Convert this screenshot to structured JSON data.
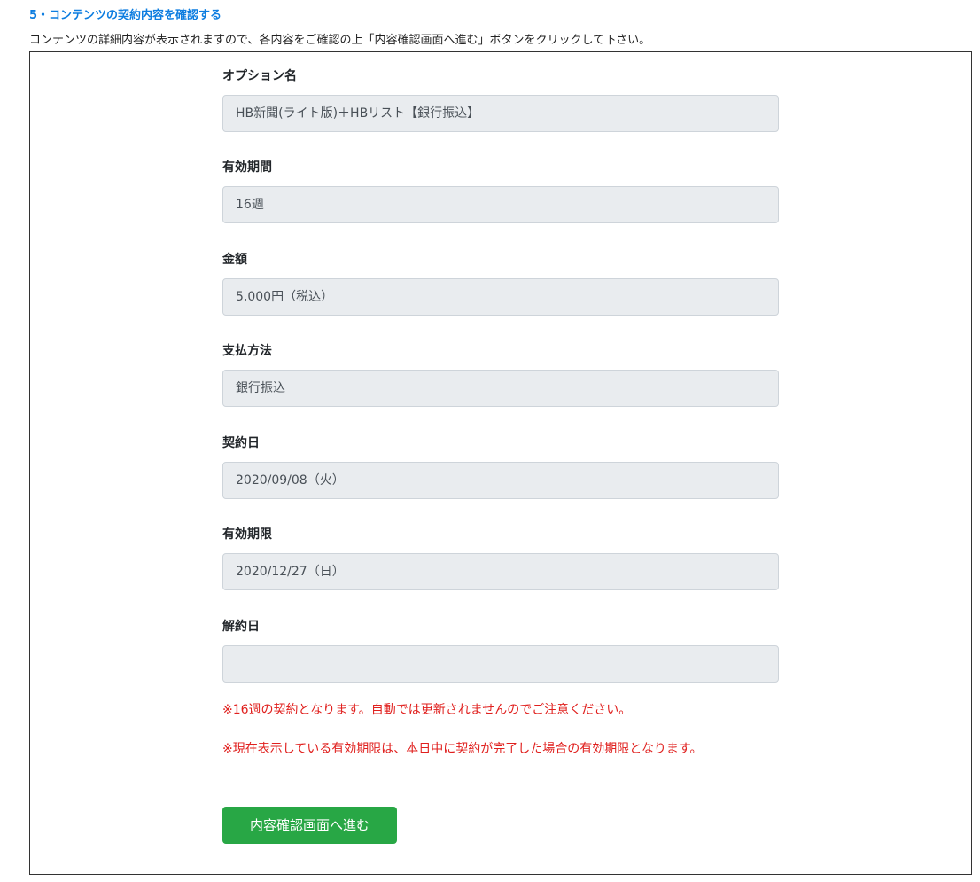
{
  "section": {
    "heading": "5・コンテンツの契約内容を確認する",
    "description": "コンテンツの詳細内容が表示されますので、各内容をご確認の上「内容確認画面へ進む」ボタンをクリックして下さい。"
  },
  "fields": {
    "option_name": {
      "label": "オプション名",
      "value": "HB新聞(ライト版)＋HBリスト【銀行振込】"
    },
    "validity_period": {
      "label": "有効期間",
      "value": "16週"
    },
    "amount": {
      "label": "金額",
      "value": "5,000円（税込）"
    },
    "payment_method": {
      "label": "支払方法",
      "value": "銀行振込"
    },
    "contract_date": {
      "label": "契約日",
      "value": "2020/09/08（火）"
    },
    "expiry_date": {
      "label": "有効期限",
      "value": "2020/12/27（日）"
    },
    "cancellation_date": {
      "label": "解約日",
      "value": ""
    }
  },
  "notices": [
    "※16週の契約となります。自動では更新されませんのでご注意ください。",
    "※現在表示している有効期限は、本日中に契約が完了した場合の有効期限となります。"
  ],
  "actions": {
    "proceed_label": "内容確認画面へ進む"
  },
  "colors": {
    "heading": "#0d7de0",
    "notice": "#e0201e",
    "button": "#28a745",
    "input_bg": "#e9ecef"
  }
}
